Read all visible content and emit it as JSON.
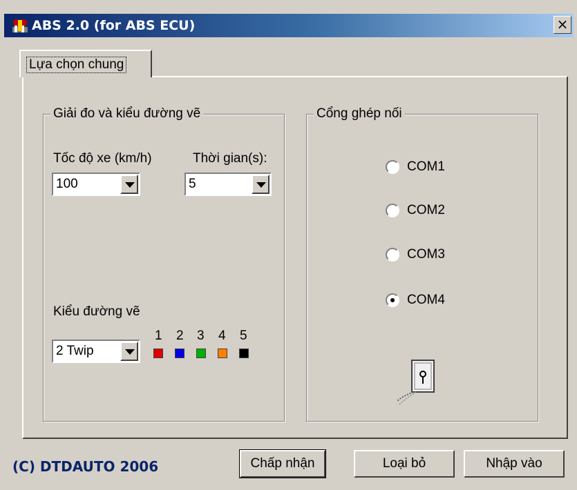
{
  "window": {
    "title": "ABS 2.0 (for ABS ECU)",
    "close_label": "×",
    "icon": "app-icon"
  },
  "tabs": [
    {
      "label": "Lựa chọn chung",
      "active": true
    }
  ],
  "range_group": {
    "title": "Giải đo và kiểu đường vẽ",
    "speed": {
      "label": "Tốc độ xe (km/h)",
      "value": "100"
    },
    "time": {
      "label": "Thời gian(s):",
      "value": "5"
    },
    "line_style": {
      "label": "Kiểu đường vẽ",
      "value": "2 Twip",
      "swatches": [
        {
          "num": "1",
          "color": "#e00000"
        },
        {
          "num": "2",
          "color": "#0000e0"
        },
        {
          "num": "3",
          "color": "#00b000"
        },
        {
          "num": "4",
          "color": "#ff8000"
        },
        {
          "num": "5",
          "color": "#000000"
        }
      ]
    }
  },
  "port_group": {
    "title": "Cổng ghép nối",
    "options": [
      {
        "label": "COM1",
        "selected": false
      },
      {
        "label": "COM2",
        "selected": false
      },
      {
        "label": "COM3",
        "selected": false
      },
      {
        "label": "COM4",
        "selected": true
      }
    ],
    "icon": "serial-port-connector-icon"
  },
  "footer": {
    "copyright": "(C) DTDAUTO 2006",
    "accept_label": "Chấp nhận",
    "cancel_label": "Loại bỏ",
    "import_label": "Nhập vào"
  },
  "colors": {
    "titlebar_start": "#0a246a",
    "titlebar_end": "#a6caf0",
    "face": "#d4d0c8",
    "copyright": "#0a246a"
  }
}
